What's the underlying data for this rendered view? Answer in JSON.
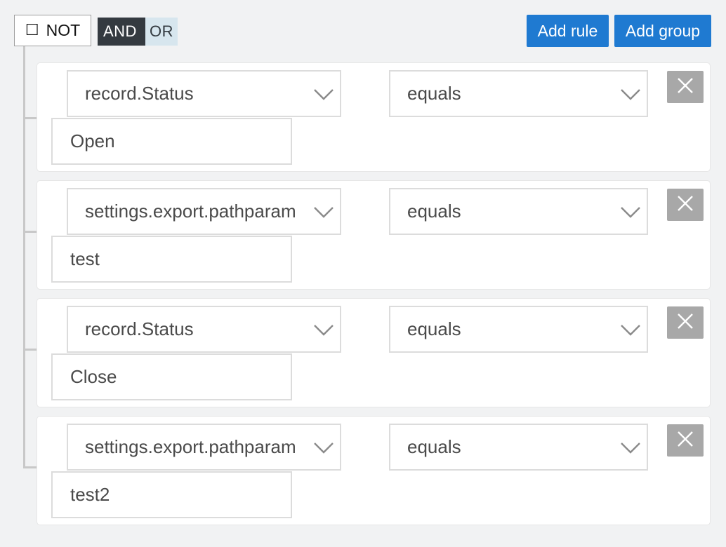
{
  "header": {
    "not_label": "NOT",
    "not_checkbox_glyph": "☐",
    "conjunctions": [
      {
        "label": "AND",
        "active": true
      },
      {
        "label": "OR",
        "active": false
      }
    ],
    "add_rule_label": "Add rule",
    "add_group_label": "Add group"
  },
  "rules": [
    {
      "field": "record.Status",
      "operator": "equals",
      "value": "Open"
    },
    {
      "field": "settings.export.pathparam",
      "operator": "equals",
      "value": "test"
    },
    {
      "field": "record.Status",
      "operator": "equals",
      "value": "Close"
    },
    {
      "field": "settings.export.pathparam",
      "operator": "equals",
      "value": "test2"
    }
  ],
  "icons": {
    "dropdown": "chevron-down-icon",
    "delete": "close-icon"
  },
  "colors": {
    "primary_button": "#1f7ad1",
    "active_conjunction": "#343a40",
    "inactive_conjunction": "#d7e6ee",
    "delete_button": "#a8a8a8",
    "background": "#f1f2f3"
  }
}
